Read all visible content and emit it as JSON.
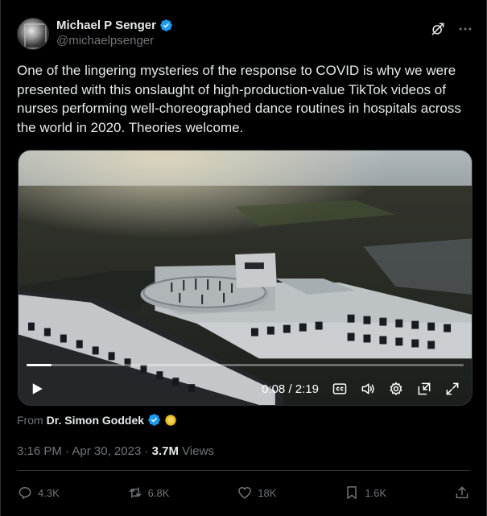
{
  "author": {
    "display_name": "Michael P Senger",
    "handle": "@michaelpsenger",
    "verified_icon": "verified-badge-icon"
  },
  "tweet": {
    "text": "One of the lingering mysteries of the response to COVID is why we were presented with this onslaught of high-production-value TikTok videos of nurses performing well-choreographed dance routines in hospitals across the world in 2020. Theories welcome."
  },
  "video": {
    "current_time": "0:08",
    "separator": " / ",
    "duration": "2:19",
    "progress_fraction": 0.057
  },
  "source": {
    "from_label": "From",
    "name": "Dr. Simon Goddek"
  },
  "meta": {
    "time": "3:16 PM",
    "dot1": " · ",
    "date": "Apr 30, 2023",
    "dot2": " · ",
    "views_count": "3.7M",
    "views_label": " Views"
  },
  "actions": {
    "replies": "4.3K",
    "reposts": "6.8K",
    "likes": "18K",
    "bookmarks": "1.6K"
  },
  "colors": {
    "background": "#000000",
    "text": "#e7e9ea",
    "muted": "#71767b",
    "verified": "#1d9bf0",
    "divider": "#2f3336"
  }
}
